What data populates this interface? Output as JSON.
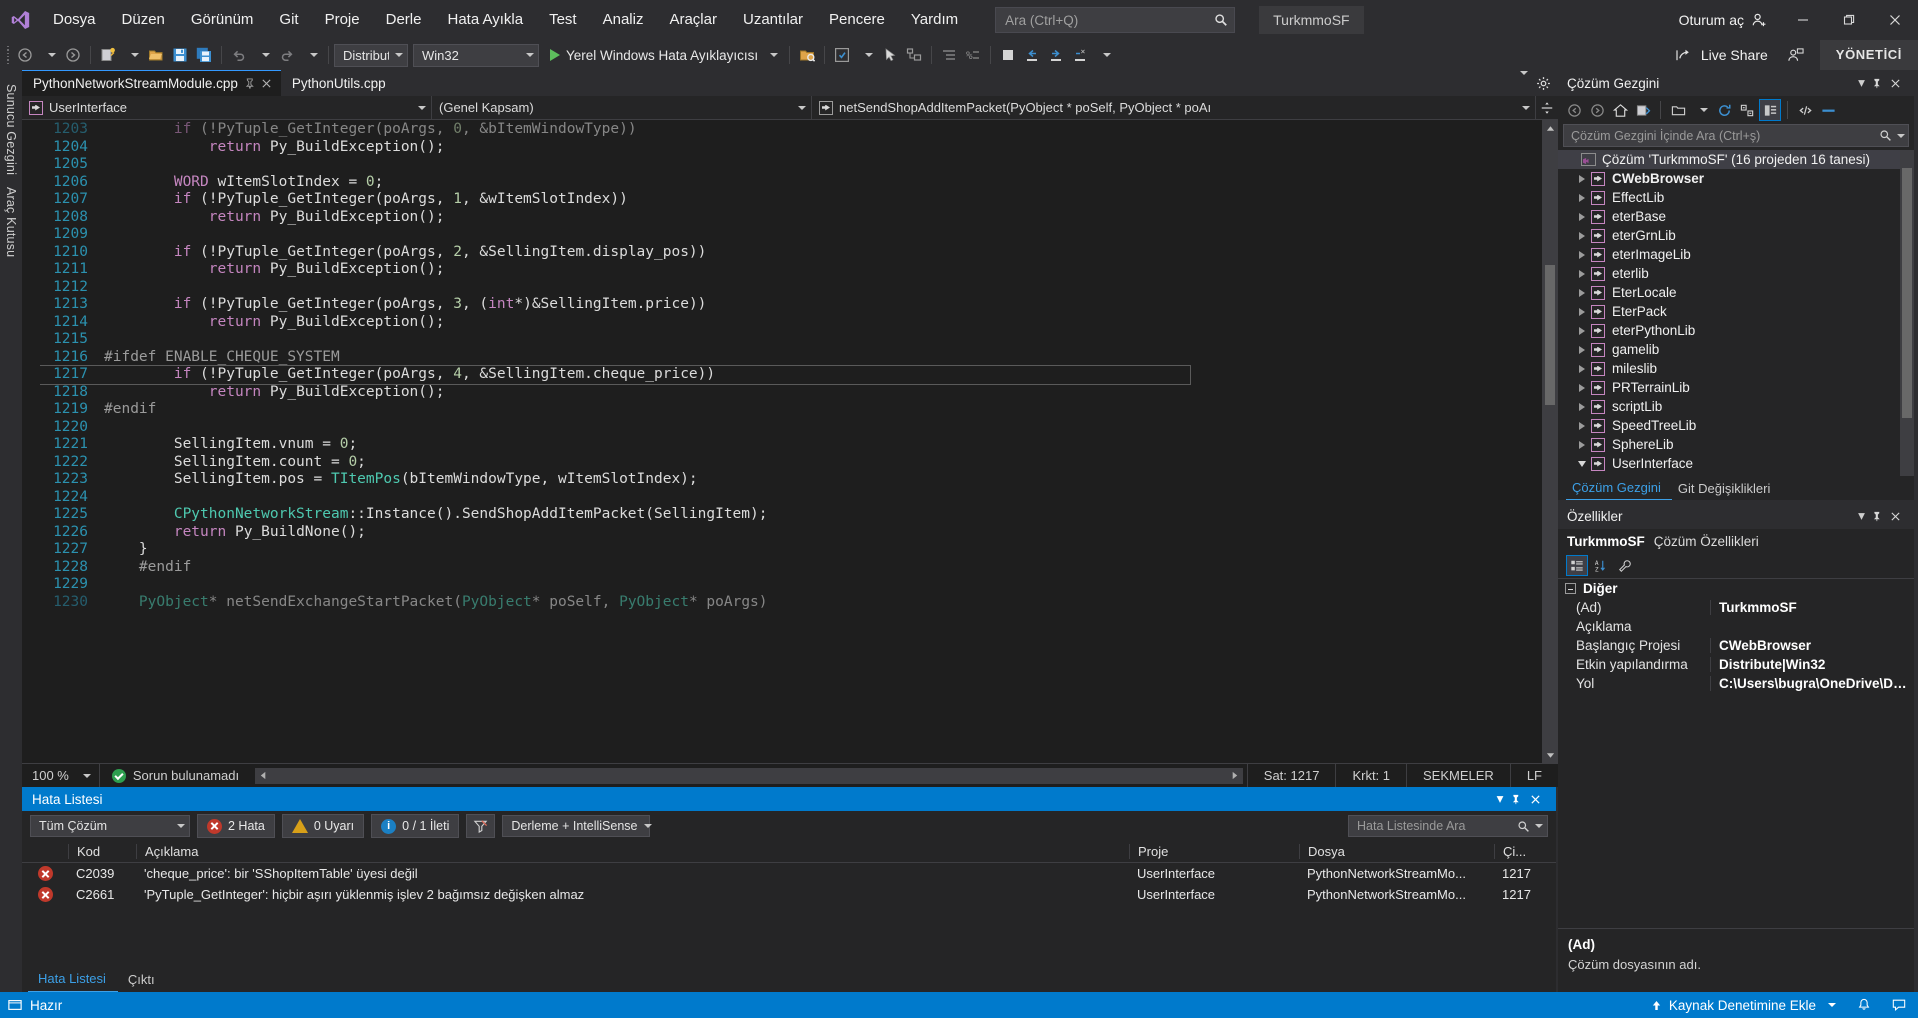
{
  "window": {
    "solution_chip": "TurkmmoSF",
    "account_label": "Oturum aç",
    "minimize": "—",
    "restore": "❐",
    "close": "✕"
  },
  "menu": {
    "items": [
      "Dosya",
      "Düzen",
      "Görünüm",
      "Git",
      "Proje",
      "Derle",
      "Hata Ayıkla",
      "Test",
      "Analiz",
      "Araçlar",
      "Uzantılar",
      "Pencere",
      "Yardım"
    ]
  },
  "search": {
    "placeholder": "Ara (Ctrl+Q)",
    "value": ""
  },
  "toolbar": {
    "config": "Distribut",
    "platform": "Win32",
    "run_label": "Yerel Windows Hata Ayıklayıcısı",
    "live_share": "Live Share",
    "admin": "YÖNETİCİ"
  },
  "rail": {
    "labels": [
      "Sunucu Gezgini",
      "Araç Kutusu"
    ]
  },
  "editor": {
    "tabs": [
      {
        "label": "PythonNetworkStreamModule.cpp",
        "active": true
      },
      {
        "label": "PythonUtils.cpp",
        "active": false
      }
    ],
    "nav": {
      "project": "UserInterface",
      "scope": "(Genel Kapsam)",
      "member": "netSendShopAddItemPacket(PyObject * poSelf, PyObject * poAı"
    },
    "zoom": "100 %",
    "status_message": "Sorun bulunamadı",
    "line_label": "Sat: 1217",
    "col_label": "Krkt: 1",
    "tabs_mode": "SEKMELER",
    "eol": "LF",
    "lines": [
      {
        "n": "1203",
        "text": "\t\tif (!PyTuple_GetInteger(poArgs, 0, &bItemWindowType))",
        "clipped": true
      },
      {
        "n": "1204",
        "text": "\t\t\treturn Py_BuildException();"
      },
      {
        "n": "1205",
        "text": ""
      },
      {
        "n": "1206",
        "text": "\t\tWORD wItemSlotIndex = 0;"
      },
      {
        "n": "1207",
        "text": "\t\tif (!PyTuple_GetInteger(poArgs, 1, &wItemSlotIndex))"
      },
      {
        "n": "1208",
        "text": "\t\t\treturn Py_BuildException();"
      },
      {
        "n": "1209",
        "text": ""
      },
      {
        "n": "1210",
        "text": "\t\tif (!PyTuple_GetInteger(poArgs, 2, &SellingItem.display_pos))"
      },
      {
        "n": "1211",
        "text": "\t\t\treturn Py_BuildException();"
      },
      {
        "n": "1212",
        "text": ""
      },
      {
        "n": "1213",
        "text": "\t\tif (!PyTuple_GetInteger(poArgs, 3, (int*)&SellingItem.price))"
      },
      {
        "n": "1214",
        "text": "\t\t\treturn Py_BuildException();"
      },
      {
        "n": "1215",
        "text": ""
      },
      {
        "n": "1216",
        "text": "#ifdef ENABLE_CHEQUE_SYSTEM"
      },
      {
        "n": "1217",
        "text": "\t\tif (!PyTuple_GetInteger(poArgs, 4, &SellingItem.cheque_price))",
        "highlight": true
      },
      {
        "n": "1218",
        "text": "\t\t\treturn Py_BuildException();"
      },
      {
        "n": "1219",
        "text": "#endif"
      },
      {
        "n": "1220",
        "text": ""
      },
      {
        "n": "1221",
        "text": "\t\tSellingItem.vnum = 0;"
      },
      {
        "n": "1222",
        "text": "\t\tSellingItem.count = 0;"
      },
      {
        "n": "1223",
        "text": "\t\tSellingItem.pos = TItemPos(bItemWindowType, wItemSlotIndex);"
      },
      {
        "n": "1224",
        "text": ""
      },
      {
        "n": "1225",
        "text": "\t\tCPythonNetworkStream::Instance().SendShopAddItemPacket(SellingItem);"
      },
      {
        "n": "1226",
        "text": "\t\treturn Py_BuildNone();"
      },
      {
        "n": "1227",
        "text": "\t}"
      },
      {
        "n": "1228",
        "text": "\t#endif"
      },
      {
        "n": "1229",
        "text": ""
      },
      {
        "n": "1230",
        "text": "\tPyObject* netSendExchangeStartPacket(PyObject* poSelf, PyObject* poArgs)",
        "clipped": true
      }
    ]
  },
  "error_list": {
    "title": "Hata Listesi",
    "scope_filter": "Tüm Çözüm",
    "errors_label": "2 Hata",
    "warnings_label": "0 Uyarı",
    "messages_label": "0 / 1 İleti",
    "build_filter": "Derleme + IntelliSense",
    "search_placeholder": "Hata Listesinde Ara",
    "columns": [
      "",
      "Kod",
      "Açıklama",
      "Proje",
      "Dosya",
      "Çi..."
    ],
    "rows": [
      {
        "severity": "error",
        "code": "C2039",
        "description": "'cheque_price': bir 'SShopItemTable' üyesi değil",
        "project": "UserInterface",
        "file": "PythonNetworkStreamMo...",
        "line": "1217"
      },
      {
        "severity": "error",
        "code": "C2661",
        "description": "'PyTuple_GetInteger': hiçbir aşırı yüklenmiş işlev 2 bağımsız değişken almaz",
        "project": "UserInterface",
        "file": "PythonNetworkStreamMo...",
        "line": "1217"
      }
    ],
    "footer_tabs": [
      {
        "label": "Hata Listesi",
        "selected": true
      },
      {
        "label": "Çıktı",
        "selected": false
      }
    ]
  },
  "solution_explorer": {
    "title": "Çözüm Gezgini",
    "search_placeholder": "Çözüm Gezgini İçinde Ara (Ctrl+ş)",
    "root": "Çözüm 'TurkmmoSF' (16 projeden 16 tanesi)",
    "projects": [
      {
        "name": "CWebBrowser",
        "bold": true,
        "expanded": false
      },
      {
        "name": "EffectLib",
        "bold": false,
        "expanded": false
      },
      {
        "name": "eterBase",
        "bold": false,
        "expanded": false
      },
      {
        "name": "eterGrnLib",
        "bold": false,
        "expanded": false
      },
      {
        "name": "eterImageLib",
        "bold": false,
        "expanded": false
      },
      {
        "name": "eterlib",
        "bold": false,
        "expanded": false
      },
      {
        "name": "EterLocale",
        "bold": false,
        "expanded": false
      },
      {
        "name": "EterPack",
        "bold": false,
        "expanded": false
      },
      {
        "name": "eterPythonLib",
        "bold": false,
        "expanded": false
      },
      {
        "name": "gamelib",
        "bold": false,
        "expanded": false
      },
      {
        "name": "mileslib",
        "bold": false,
        "expanded": false
      },
      {
        "name": "PRTerrainLib",
        "bold": false,
        "expanded": false
      },
      {
        "name": "scriptLib",
        "bold": false,
        "expanded": false
      },
      {
        "name": "SpeedTreeLib",
        "bold": false,
        "expanded": false
      },
      {
        "name": "SphereLib",
        "bold": false,
        "expanded": false
      },
      {
        "name": "UserInterface",
        "bold": false,
        "expanded": true
      }
    ],
    "footer_tabs": [
      {
        "label": "Çözüm Gezgini",
        "selected": true
      },
      {
        "label": "Git Değişiklikleri",
        "selected": false
      }
    ]
  },
  "properties": {
    "title": "Özellikler",
    "object_name": "TurkmmoSF",
    "object_type": "Çözüm Özellikleri",
    "category": "Diğer",
    "rows": [
      {
        "key": "(Ad)",
        "value": "TurkmmoSF"
      },
      {
        "key": "Açıklama",
        "value": ""
      },
      {
        "key": "Başlangıç Projesi",
        "value": "CWebBrowser"
      },
      {
        "key": "Etkin yapılandırma",
        "value": "Distribute|Win32"
      },
      {
        "key": "Yol",
        "value": "C:\\Users\\bugra\\OneDrive\\Desk"
      }
    ],
    "desc_title": "(Ad)",
    "desc_text": "Çözüm dosyasının adı."
  },
  "statusbar": {
    "ready": "Hazır",
    "source_control": "Kaynak Denetimine Ekle"
  },
  "colors": {
    "accent": "#007acc",
    "error": "#c0392b",
    "warning": "#d8a019",
    "info": "#1b80c4",
    "ok": "#2e9e4f",
    "link": "#3ca0e7",
    "project_icon": "#c586c0"
  }
}
